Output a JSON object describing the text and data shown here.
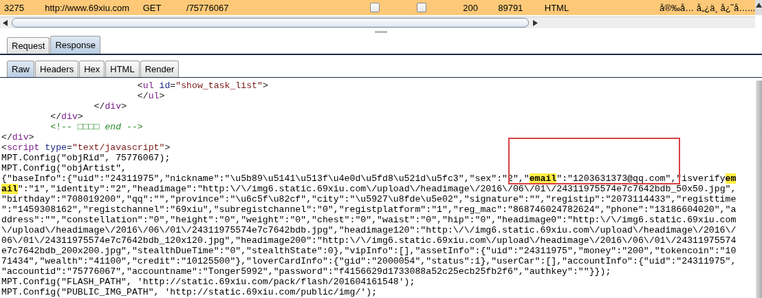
{
  "request_row": {
    "selected": true,
    "cells": [
      {
        "kind": "text",
        "text": "3275"
      },
      {
        "kind": "text",
        "text": "http://www.69xiu.com"
      },
      {
        "kind": "text",
        "text": "GET"
      },
      {
        "kind": "text",
        "text": "/75776067"
      },
      {
        "kind": "checkbox",
        "checked": false
      },
      {
        "kind": "checkbox",
        "checked": false
      },
      {
        "kind": "text",
        "text": "200"
      },
      {
        "kind": "text",
        "text": "89791"
      },
      {
        "kind": "text",
        "text": "HTML"
      },
      {
        "kind": "text",
        "text": "å®‰å… å„¿ä¸ å¿˜å…..."
      }
    ]
  },
  "message_tabs": [
    {
      "label": "Request",
      "selected": false
    },
    {
      "label": "Response",
      "selected": true
    }
  ],
  "view_tabs": [
    {
      "label": "Raw",
      "selected": true
    },
    {
      "label": "Headers",
      "selected": false
    },
    {
      "label": "Hex",
      "selected": false
    },
    {
      "label": "HTML",
      "selected": false
    },
    {
      "label": "Render",
      "selected": false
    }
  ],
  "code_lines": [
    {
      "segments": [
        {
          "kind": "punct",
          "text": "                         <"
        },
        {
          "kind": "tag",
          "text": "ul"
        },
        {
          "kind": "attr",
          "text": " id"
        },
        {
          "kind": "punct",
          "text": "="
        },
        {
          "kind": "value",
          "text": "\"show_task_list\""
        },
        {
          "kind": "punct",
          "text": ">"
        }
      ]
    },
    {
      "segments": [
        {
          "kind": "punct",
          "text": "                         </"
        },
        {
          "kind": "tag",
          "text": "ul"
        },
        {
          "kind": "punct",
          "text": ">"
        }
      ]
    },
    {
      "segments": [
        {
          "kind": "punct",
          "text": "                 </"
        },
        {
          "kind": "tag",
          "text": "div"
        },
        {
          "kind": "punct",
          "text": ">"
        }
      ]
    },
    {
      "segments": [
        {
          "kind": "punct",
          "text": "         </"
        },
        {
          "kind": "tag",
          "text": "div"
        },
        {
          "kind": "punct",
          "text": ">"
        }
      ]
    },
    {
      "segments": [
        {
          "kind": "comment",
          "text": "         <!-- □□□□ *end* -->"
        }
      ]
    },
    {
      "segments": [
        {
          "kind": "punct",
          "text": "</"
        },
        {
          "kind": "tag",
          "text": "div"
        },
        {
          "kind": "punct",
          "text": ">"
        }
      ]
    },
    {
      "segments": [
        {
          "kind": "punct",
          "text": "<"
        },
        {
          "kind": "tag",
          "text": "script"
        },
        {
          "kind": "attr",
          "text": " type"
        },
        {
          "kind": "punct",
          "text": "="
        },
        {
          "kind": "value",
          "text": "\"text/javascript\""
        },
        {
          "kind": "punct",
          "text": ">"
        }
      ]
    },
    {
      "segments": [
        {
          "kind": "plain",
          "text": "MPT.Config(\"objRid\", 75776067);"
        }
      ]
    },
    {
      "segments": [
        {
          "kind": "plain",
          "text": "MPT.Config(\"objArtist\","
        }
      ]
    },
    {
      "segments": [
        {
          "kind": "plain",
          "text": "{\"baseInfo\":{\"uid\":\"24311975\",\"nickname\":\"\\u5b89\\u5141\\u513f\\u4e0d\\u5fd8\\u521d\\u5fc3\",\"sex\":\"2\",\""
        },
        {
          "kind": "mark",
          "text": "email"
        },
        {
          "kind": "plain",
          "text": "\":\"1203631373@qq.com\",\"isverify"
        },
        {
          "kind": "mark",
          "text": "em"
        }
      ]
    },
    {
      "segments": [
        {
          "kind": "mark",
          "text": "ail"
        },
        {
          "kind": "plain",
          "text": "\":\"1\",\"identity\":\"2\",\"headimage\":\"http:\\/\\/img6.static.69xiu.com\\/upload\\/headimage\\/2016\\/06\\/01\\/24311975574e7c7642bdb_50x50.jpg\","
        }
      ]
    },
    {
      "segments": [
        {
          "kind": "plain",
          "text": "\"birthday\":\"708019200\",\"qq\":\"\",\"province\":\"\\u6c5f\\u82cf\",\"city\":\"\\u5927\\u8fde\\u5e02\",\"signature\":\"\",\"registip\":\"2073114433\",\"registtime"
        }
      ]
    },
    {
      "segments": [
        {
          "kind": "plain",
          "text": "\":\"1459308162\",\"registchannel\":\"69xiu\",\"subregistchannel\":\"0\",\"registplatform\":\"1\",\"reg_mac\":\"868746024782624\",\"phone\":\"13186604020\",\"a"
        }
      ]
    },
    {
      "segments": [
        {
          "kind": "plain",
          "text": "ddress\":\"\",\"constellation\":\"0\",\"height\":\"0\",\"weight\":\"0\",\"chest\":\"0\",\"waist\":\"0\",\"hip\":\"0\",\"headimage0\":\"http:\\/\\/img6.static.69xiu.com"
        }
      ]
    },
    {
      "segments": [
        {
          "kind": "plain",
          "text": "\\/upload\\/headimage\\/2016\\/06\\/01\\/24311975574e7c7642bdb.jpg\",\"headimage120\":\"http:\\/\\/img6.static.69xiu.com\\/upload\\/headimage\\/2016\\/"
        }
      ]
    },
    {
      "segments": [
        {
          "kind": "plain",
          "text": "06\\/01\\/24311975574e7c7642bdb_120x120.jpg\",\"headimage200\":\"http:\\/\\/img6.static.69xiu.com\\/upload\\/headimage\\/2016\\/06\\/01\\/24311975574"
        }
      ]
    },
    {
      "segments": [
        {
          "kind": "plain",
          "text": "e7c7642bdb_200x200.jpg\",\"stealthDueTime\":\"0\",\"stealthState\":0},\"vipInfo\":[],\"assetInfo\":{\"uid\":\"24311975\",\"money\":\"200\",\"tokencoin\":\"10"
        }
      ]
    },
    {
      "segments": [
        {
          "kind": "plain",
          "text": "71434\",\"wealth\":\"41100\",\"credit\":\"10125500\"},\"loverCardInfo\":{\"gid\":\"2000054\",\"status\":1},\"userCar\":[],\"accountInfo\":{\"uid\":\"24311975\","
        }
      ]
    },
    {
      "segments": [
        {
          "kind": "plain",
          "text": "\"accountid\":\"75776067\",\"accountname\":\"Tonger5992\",\"password\":\"f4156629d1733088a52c25ecb25fb2f6\",\"authkey\":\"\"}});"
        }
      ]
    },
    {
      "segments": [
        {
          "kind": "plain",
          "text": "MPT.Config(\"FLASH_PATH\", 'http://static.69xiu.com/pack/flash/201604161548');"
        }
      ]
    },
    {
      "segments": [
        {
          "kind": "plain",
          "text": "MPT.Config(\"PUBLIC_IMG_PATH\", 'http://static.69xiu.com/public/img/');"
        }
      ]
    }
  ]
}
